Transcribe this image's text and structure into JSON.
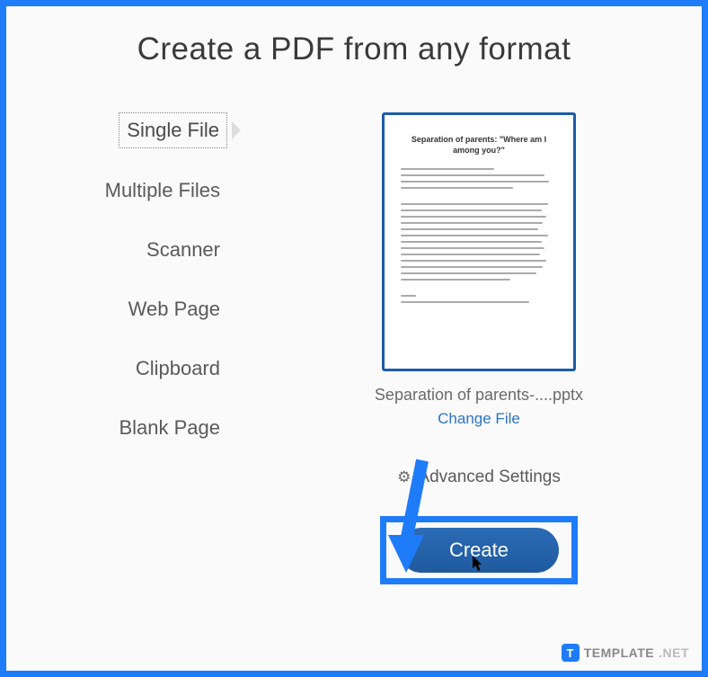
{
  "page": {
    "title": "Create a PDF from any format"
  },
  "sidebar": {
    "items": [
      {
        "label": "Single File",
        "selected": true
      },
      {
        "label": "Multiple Files",
        "selected": false
      },
      {
        "label": "Scanner",
        "selected": false
      },
      {
        "label": "Web Page",
        "selected": false
      },
      {
        "label": "Clipboard",
        "selected": false
      },
      {
        "label": "Blank Page",
        "selected": false
      }
    ]
  },
  "preview": {
    "doc_heading": "Separation of parents: \"Where am I among you?\"",
    "filename": "Separation of parents-....pptx",
    "change_file_label": "Change File",
    "advanced_settings_label": "Advanced Settings"
  },
  "actions": {
    "create_label": "Create"
  },
  "watermark": {
    "badge": "T",
    "brand": "TEMPLATE",
    "domain": ".NET"
  }
}
